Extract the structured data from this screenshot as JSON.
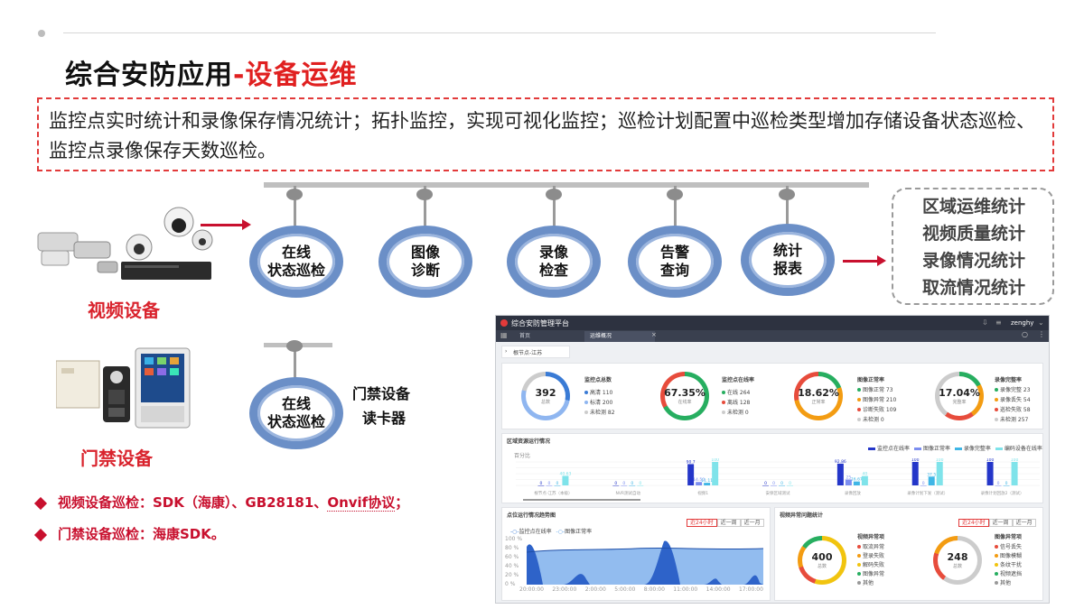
{
  "slide": {
    "title_main": "综合安防应用",
    "title_accent": "-设备运维",
    "description": "监控点实时统计和录像保存情况统计；拓扑监控，实现可视化监控；巡检计划配置中巡检类型增加存储设备状态巡检、监控点录像保存天数巡检。"
  },
  "flow": {
    "nodes": [
      {
        "line1": "在线",
        "line2": "状态巡检"
      },
      {
        "line1": "图像",
        "line2": "诊断"
      },
      {
        "line1": "录像",
        "line2": "检查"
      },
      {
        "line1": "告警",
        "line2": "查询"
      },
      {
        "line1": "统计",
        "line2": "报表"
      }
    ],
    "stats": [
      "区域运维统计",
      "视频质量统计",
      "录像情况统计",
      "取流情况统计"
    ],
    "video_label": "视频设备",
    "access_label": "门禁设备",
    "access_node": {
      "line1": "在线",
      "line2": "状态巡检"
    },
    "access_items": [
      "门禁设备",
      "读卡器"
    ]
  },
  "bullets": [
    {
      "pre": "视频设备巡检：SDK（海康）、GB28181、",
      "u": "Onvif协议",
      "post": "；"
    },
    {
      "pre": "门禁设备巡检：海康SDK。",
      "u": "",
      "post": ""
    }
  ],
  "dashboard": {
    "app_title": "综合安防管理平台",
    "user": "zenghy",
    "tabs": [
      "首页",
      "运维概况"
    ],
    "breadcrumb": "根节点-江苏",
    "kpis": [
      {
        "title": "监控点总数",
        "value": "392",
        "sub": "总数",
        "items": [
          "高清 110",
          "标清 200",
          "未检测 82"
        ],
        "colors": [
          "#3a7bd5",
          "#8fb6f0",
          "#cccccc"
        ]
      },
      {
        "title": "监控点在线率",
        "value": "67.35%",
        "sub": "在线率",
        "items": [
          "在线 264",
          "离线 128",
          "未检测 0"
        ],
        "colors": [
          "#27ae60",
          "#e74c3c",
          "#cccccc"
        ]
      },
      {
        "title": "图像正常率",
        "value": "18.62%",
        "sub": "正常率",
        "items": [
          "图像正常 73",
          "图像异常 210",
          "诊断失败 109",
          "未检测 0"
        ],
        "colors": [
          "#27ae60",
          "#f39c12",
          "#e74c3c",
          "#cccccc"
        ]
      },
      {
        "title": "录像完整率",
        "value": "17.04%",
        "sub": "完整率",
        "items": [
          "录像完整 23",
          "录像丢失 54",
          "巡检失败 58",
          "未检测 257"
        ],
        "colors": [
          "#27ae60",
          "#f39c12",
          "#e74c3c",
          "#cccccc"
        ]
      }
    ],
    "region": {
      "title": "区域资源运行情况",
      "unit": "百分比",
      "legend": [
        "监控点在线率",
        "图像正常率",
        "录像完整率",
        "编码设备在线率"
      ],
      "legend_colors": [
        "#2436c9",
        "#7c8ef0",
        "#3fb6e6",
        "#7fe3ea"
      ],
      "categories": [
        "根节点-江苏（本级）",
        "NVR测试自动",
        "视频1",
        "安保区域测试",
        "录像回放",
        "录像计划下发（测试）",
        "录像计划回放2（测试）"
      ],
      "series": [
        [
          0,
          0,
          90.7,
          0,
          92.86,
          100,
          100
        ],
        [
          0,
          0,
          14.5,
          0,
          25,
          0,
          0
        ],
        [
          0,
          0,
          11.11,
          0,
          16.67,
          37.5,
          0
        ],
        [
          40.63,
          0,
          100,
          0,
          40,
          100,
          100
        ]
      ],
      "labels": [
        [
          "0",
          "0",
          "90.7",
          "0",
          "92.86",
          "100",
          "100"
        ],
        [
          "0",
          "0",
          "14.50",
          "0",
          "25",
          "0",
          "0"
        ],
        [
          "0",
          "0",
          "11.11",
          "0",
          "16.67",
          "37.5",
          "0"
        ],
        [
          "40.63",
          "0",
          "100",
          "0",
          "40",
          "100",
          "100"
        ]
      ]
    },
    "trend": {
      "title": "点位运行情况趋势图",
      "legend": [
        "监控点在线率",
        "图像正常率"
      ],
      "buttons": [
        "近24小时",
        "近一周",
        "近一月"
      ],
      "yticks": [
        "100 %",
        "80 %",
        "60 %",
        "40 %",
        "20 %",
        "0 %"
      ],
      "xticks": [
        "20:00:00",
        "23:00:00",
        "2:00:00",
        "5:00:00",
        "8:00:00",
        "11:00:00",
        "14:00:00",
        "17:00:00"
      ]
    },
    "issues": {
      "title": "视频异常问题统计",
      "buttons": [
        "近24小时",
        "近一周",
        "近一月"
      ],
      "groups": [
        {
          "title": "视频异常项",
          "value": "400",
          "sub": "总数",
          "items": [
            "取流异常",
            "登录失败",
            "解码失败",
            "图像异常",
            "其他"
          ],
          "colors": [
            "#e74c3c",
            "#f39c12",
            "#f1c40f",
            "#27ae60",
            "#999999"
          ]
        },
        {
          "title": "图像异常项",
          "value": "248",
          "sub": "总数",
          "items": [
            "信号丢失",
            "图像模糊",
            "条纹干扰",
            "视频遮挡",
            "其他"
          ],
          "colors": [
            "#e74c3c",
            "#f39c12",
            "#f1c40f",
            "#27ae60",
            "#999999"
          ]
        }
      ]
    }
  }
}
